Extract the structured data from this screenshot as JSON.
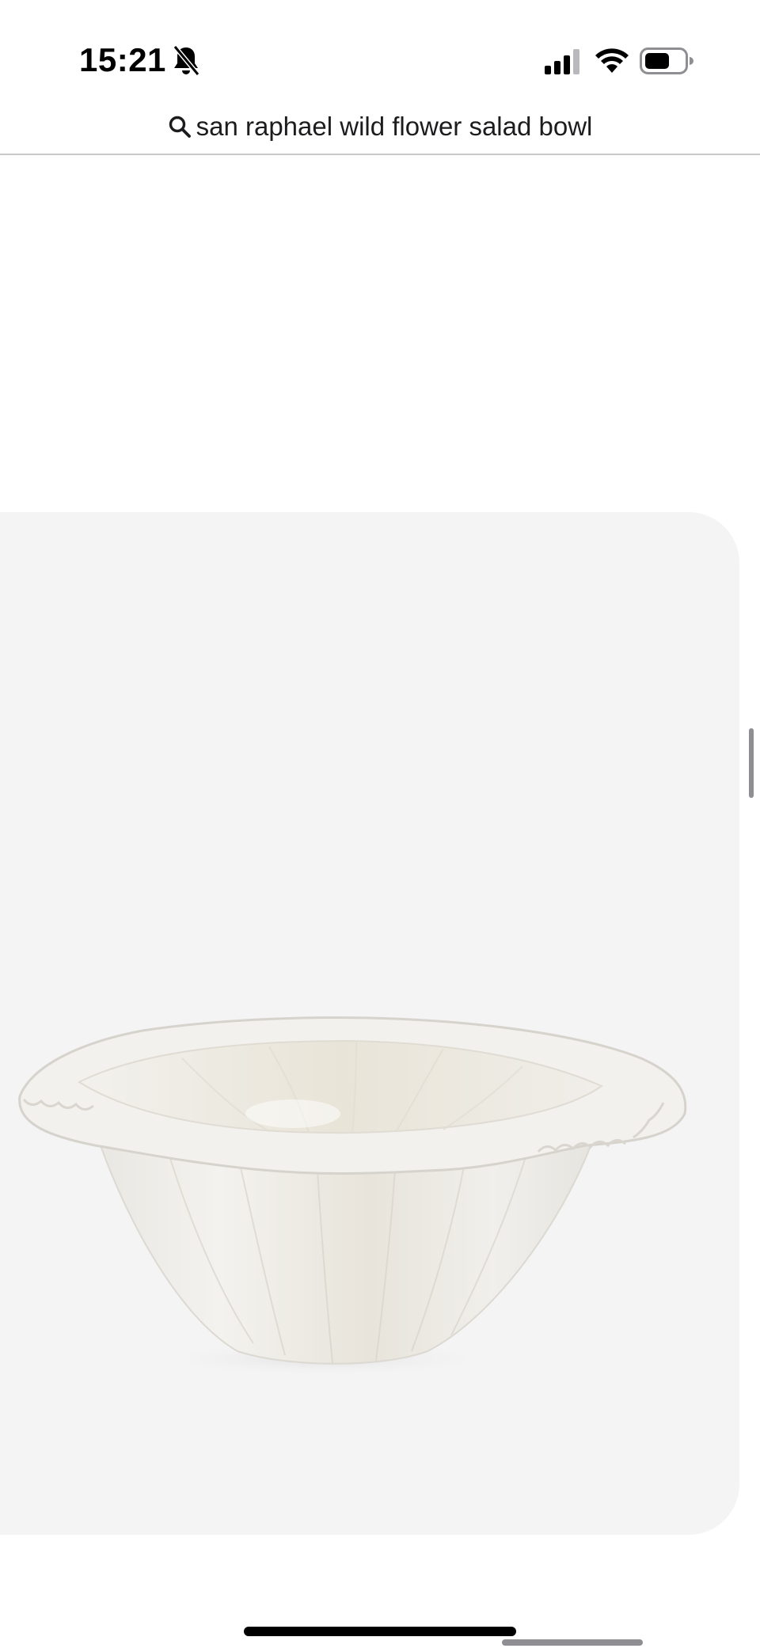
{
  "status_bar": {
    "time": "15:21",
    "icons": [
      "bell-slash-icon",
      "cellular-signal-icon",
      "wifi-icon",
      "battery-icon"
    ]
  },
  "search": {
    "query": "san raphael wild flower salad bowl",
    "icon": "search-icon"
  },
  "product": {
    "image": "white-flower-salad-bowl-image"
  },
  "colors": {
    "card_background": "#f4f4f4",
    "header_border": "#c9c9cc",
    "text": "#1c1c1e"
  }
}
